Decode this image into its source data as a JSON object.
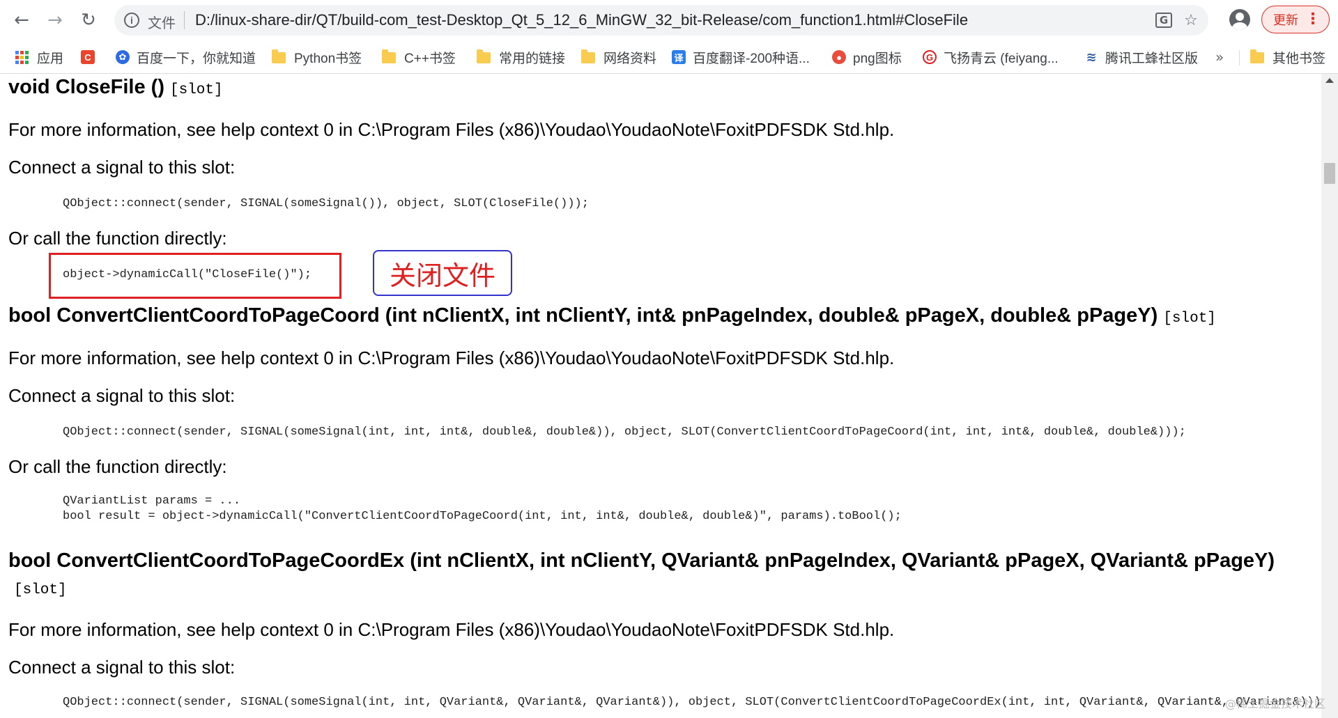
{
  "browser": {
    "url_scheme_label": "文件",
    "url": "D:/linux-share-dir/QT/build-com_test-Desktop_Qt_5_12_6_MinGW_32_bit-Release/com_function1.html#CloseFile",
    "update_label": "更新"
  },
  "bookmarks": {
    "items": [
      {
        "label": "应用"
      },
      {
        "label": ""
      },
      {
        "label": "百度一下，你就知道"
      },
      {
        "label": "Python书签"
      },
      {
        "label": "C++书签"
      },
      {
        "label": "常用的链接"
      },
      {
        "label": "网络资料"
      },
      {
        "label": "百度翻译-200种语..."
      },
      {
        "label": "png图标"
      },
      {
        "label": "飞扬青云 (feiyang..."
      },
      {
        "label": "腾讯工蜂社区版"
      }
    ],
    "more": "»",
    "other_label": "其他书签"
  },
  "sections": [
    {
      "heading": "void CloseFile ()",
      "slot": "[slot]",
      "info": "For more information, see help context 0 in C:\\Program Files (x86)\\Youdao\\YoudaoNote\\FoxitPDFSDK Std.hlp.",
      "connect_label": "Connect a signal to this slot:",
      "connect_code": "QObject::connect(sender, SIGNAL(someSignal()), object, SLOT(CloseFile()));",
      "call_label": "Or call the function directly:",
      "call_code": "object->dynamicCall(\"CloseFile()\");"
    },
    {
      "heading": "bool ConvertClientCoordToPageCoord (int nClientX, int nClientY, int& pnPageIndex, double& pPageX, double& pPageY)",
      "slot": "[slot]",
      "info": "For more information, see help context 0 in C:\\Program Files (x86)\\Youdao\\YoudaoNote\\FoxitPDFSDK Std.hlp.",
      "connect_label": "Connect a signal to this slot:",
      "connect_code": "QObject::connect(sender, SIGNAL(someSignal(int, int, int&, double&, double&)), object, SLOT(ConvertClientCoordToPageCoord(int, int, int&, double&, double&)));",
      "call_label": "Or call the function directly:",
      "call_code": "QVariantList params = ...\nbool result = object->dynamicCall(\"ConvertClientCoordToPageCoord(int, int, int&, double&, double&)\", params).toBool();"
    },
    {
      "heading": "bool ConvertClientCoordToPageCoordEx (int nClientX, int nClientY, QVariant& pnPageIndex, QVariant& pPageX, QVariant& pPageY)",
      "slot": "[slot]",
      "info": "For more information, see help context 0 in C:\\Program Files (x86)\\Youdao\\YoudaoNote\\FoxitPDFSDK Std.hlp.",
      "connect_label": "Connect a signal to this slot:",
      "connect_code": "QObject::connect(sender, SIGNAL(someSignal(int, int, QVariant&, QVariant&, QVariant&)), object, SLOT(ConvertClientCoordToPageCoordEx(int, int, QVariant&, QVariant&, QVariant&)));"
    }
  ],
  "annotation": {
    "text": "关闭文件",
    "box_color": "#e02020",
    "label_border_color": "#3333cc"
  },
  "watermark": "@稀土掘金技术社区"
}
